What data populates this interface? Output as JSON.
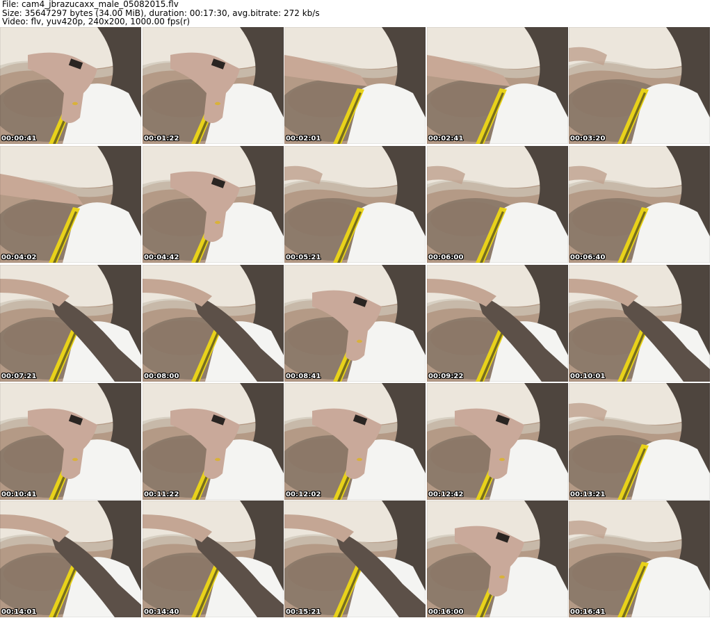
{
  "header": {
    "file_line": "File: cam4_jbrazucaxx_male_05082015.flv",
    "size_line": "Size: 35647297 bytes (34.00 MiB), duration: 00:17:30, avg.bitrate: 272 kb/s",
    "video_line": "Video: flv, yuv420p, 240x200, 1000.00 fps(r)"
  },
  "thumbnails": [
    {
      "timestamp": "00:00:41",
      "variant": "hand"
    },
    {
      "timestamp": "00:01:22",
      "variant": "hand"
    },
    {
      "timestamp": "00:02:01",
      "variant": "arm"
    },
    {
      "timestamp": "00:02:41",
      "variant": "arm"
    },
    {
      "timestamp": "00:03:20",
      "variant": "torso"
    },
    {
      "timestamp": "00:04:02",
      "variant": "arm"
    },
    {
      "timestamp": "00:04:42",
      "variant": "hand"
    },
    {
      "timestamp": "00:05:21",
      "variant": "torso"
    },
    {
      "timestamp": "00:06:00",
      "variant": "torso"
    },
    {
      "timestamp": "00:06:40",
      "variant": "torso"
    },
    {
      "timestamp": "00:07:21",
      "variant": "forearm"
    },
    {
      "timestamp": "00:08:00",
      "variant": "forearm"
    },
    {
      "timestamp": "00:08:41",
      "variant": "hand"
    },
    {
      "timestamp": "00:09:22",
      "variant": "forearm"
    },
    {
      "timestamp": "00:10:01",
      "variant": "forearm"
    },
    {
      "timestamp": "00:10:41",
      "variant": "hand"
    },
    {
      "timestamp": "00:11:22",
      "variant": "hand"
    },
    {
      "timestamp": "00:12:02",
      "variant": "hand"
    },
    {
      "timestamp": "00:12:42",
      "variant": "hand"
    },
    {
      "timestamp": "00:13:21",
      "variant": "torso"
    },
    {
      "timestamp": "00:14:01",
      "variant": "forearm"
    },
    {
      "timestamp": "00:14:40",
      "variant": "forearm"
    },
    {
      "timestamp": "00:15:21",
      "variant": "forearm"
    },
    {
      "timestamp": "00:16:00",
      "variant": "hand"
    },
    {
      "timestamp": "00:16:41",
      "variant": "torso"
    }
  ],
  "colors": {
    "skin": "#b49a86",
    "skin_dark": "#8c7566",
    "hair": "#6e6256",
    "pillow": "#ece6dc",
    "pillow_shadow": "#cfc6b8",
    "underwear": "#f4f4f2",
    "waistband": "#e8d21a",
    "waistband_dark": "#2a2a22",
    "dark_side": "#4e453e"
  }
}
